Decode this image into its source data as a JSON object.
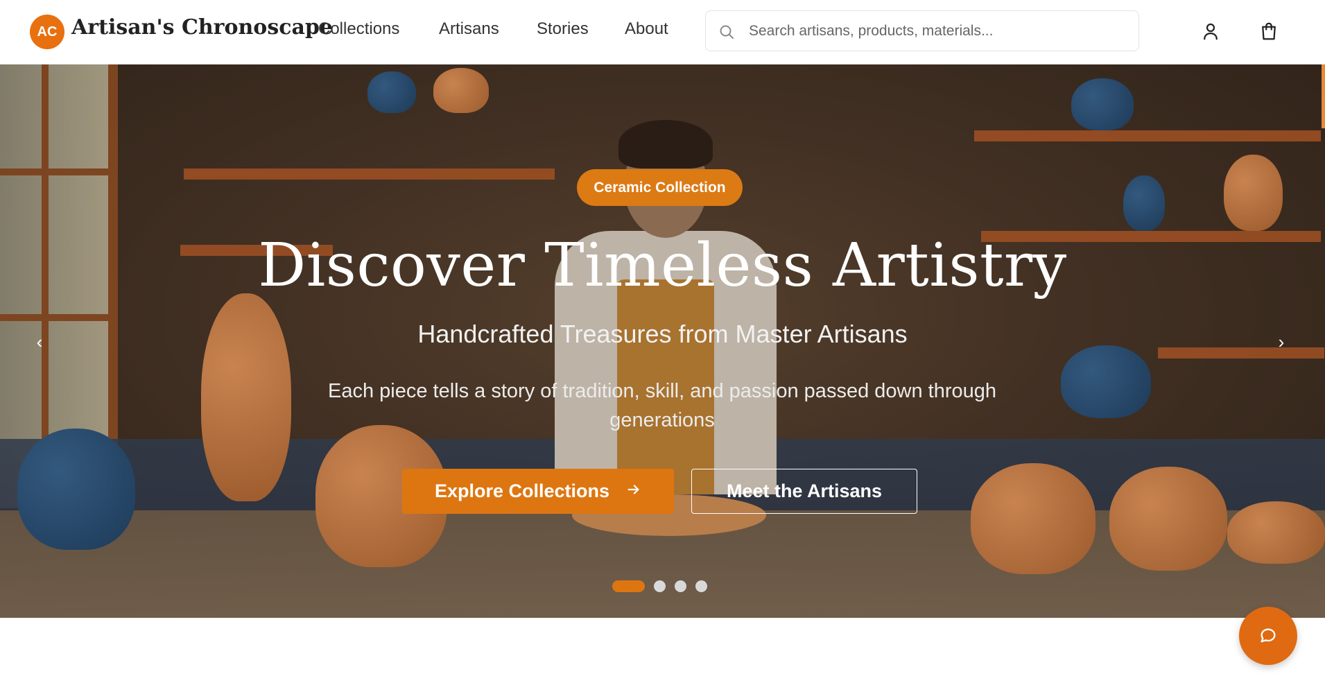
{
  "header": {
    "logo_text": "AC",
    "brand": "Artisan's Chronoscape",
    "nav": [
      "Collections",
      "Artisans",
      "Stories",
      "About"
    ],
    "search_placeholder": "Search artisans, products, materials...",
    "icons": [
      "user-icon",
      "shopping-bag-icon"
    ]
  },
  "hero": {
    "badge": "Ceramic Collection",
    "title": "Discover Timeless Artistry",
    "subtitle": "Handcrafted Treasures from Master Artisans",
    "description": "Each piece tells a story of tradition, skill, and passion passed down through generations",
    "primary_button": "Explore Collections",
    "secondary_button": "Meet the Artisans",
    "prev_arrow": "‹",
    "next_arrow": "›",
    "slides_total": 4,
    "active_slide": 1
  },
  "colors": {
    "accent": "#dd7611",
    "logo_bg": "#e8700f",
    "chat_bg": "#e06a12"
  },
  "chat": {
    "icon": "chat-bubble-icon"
  }
}
